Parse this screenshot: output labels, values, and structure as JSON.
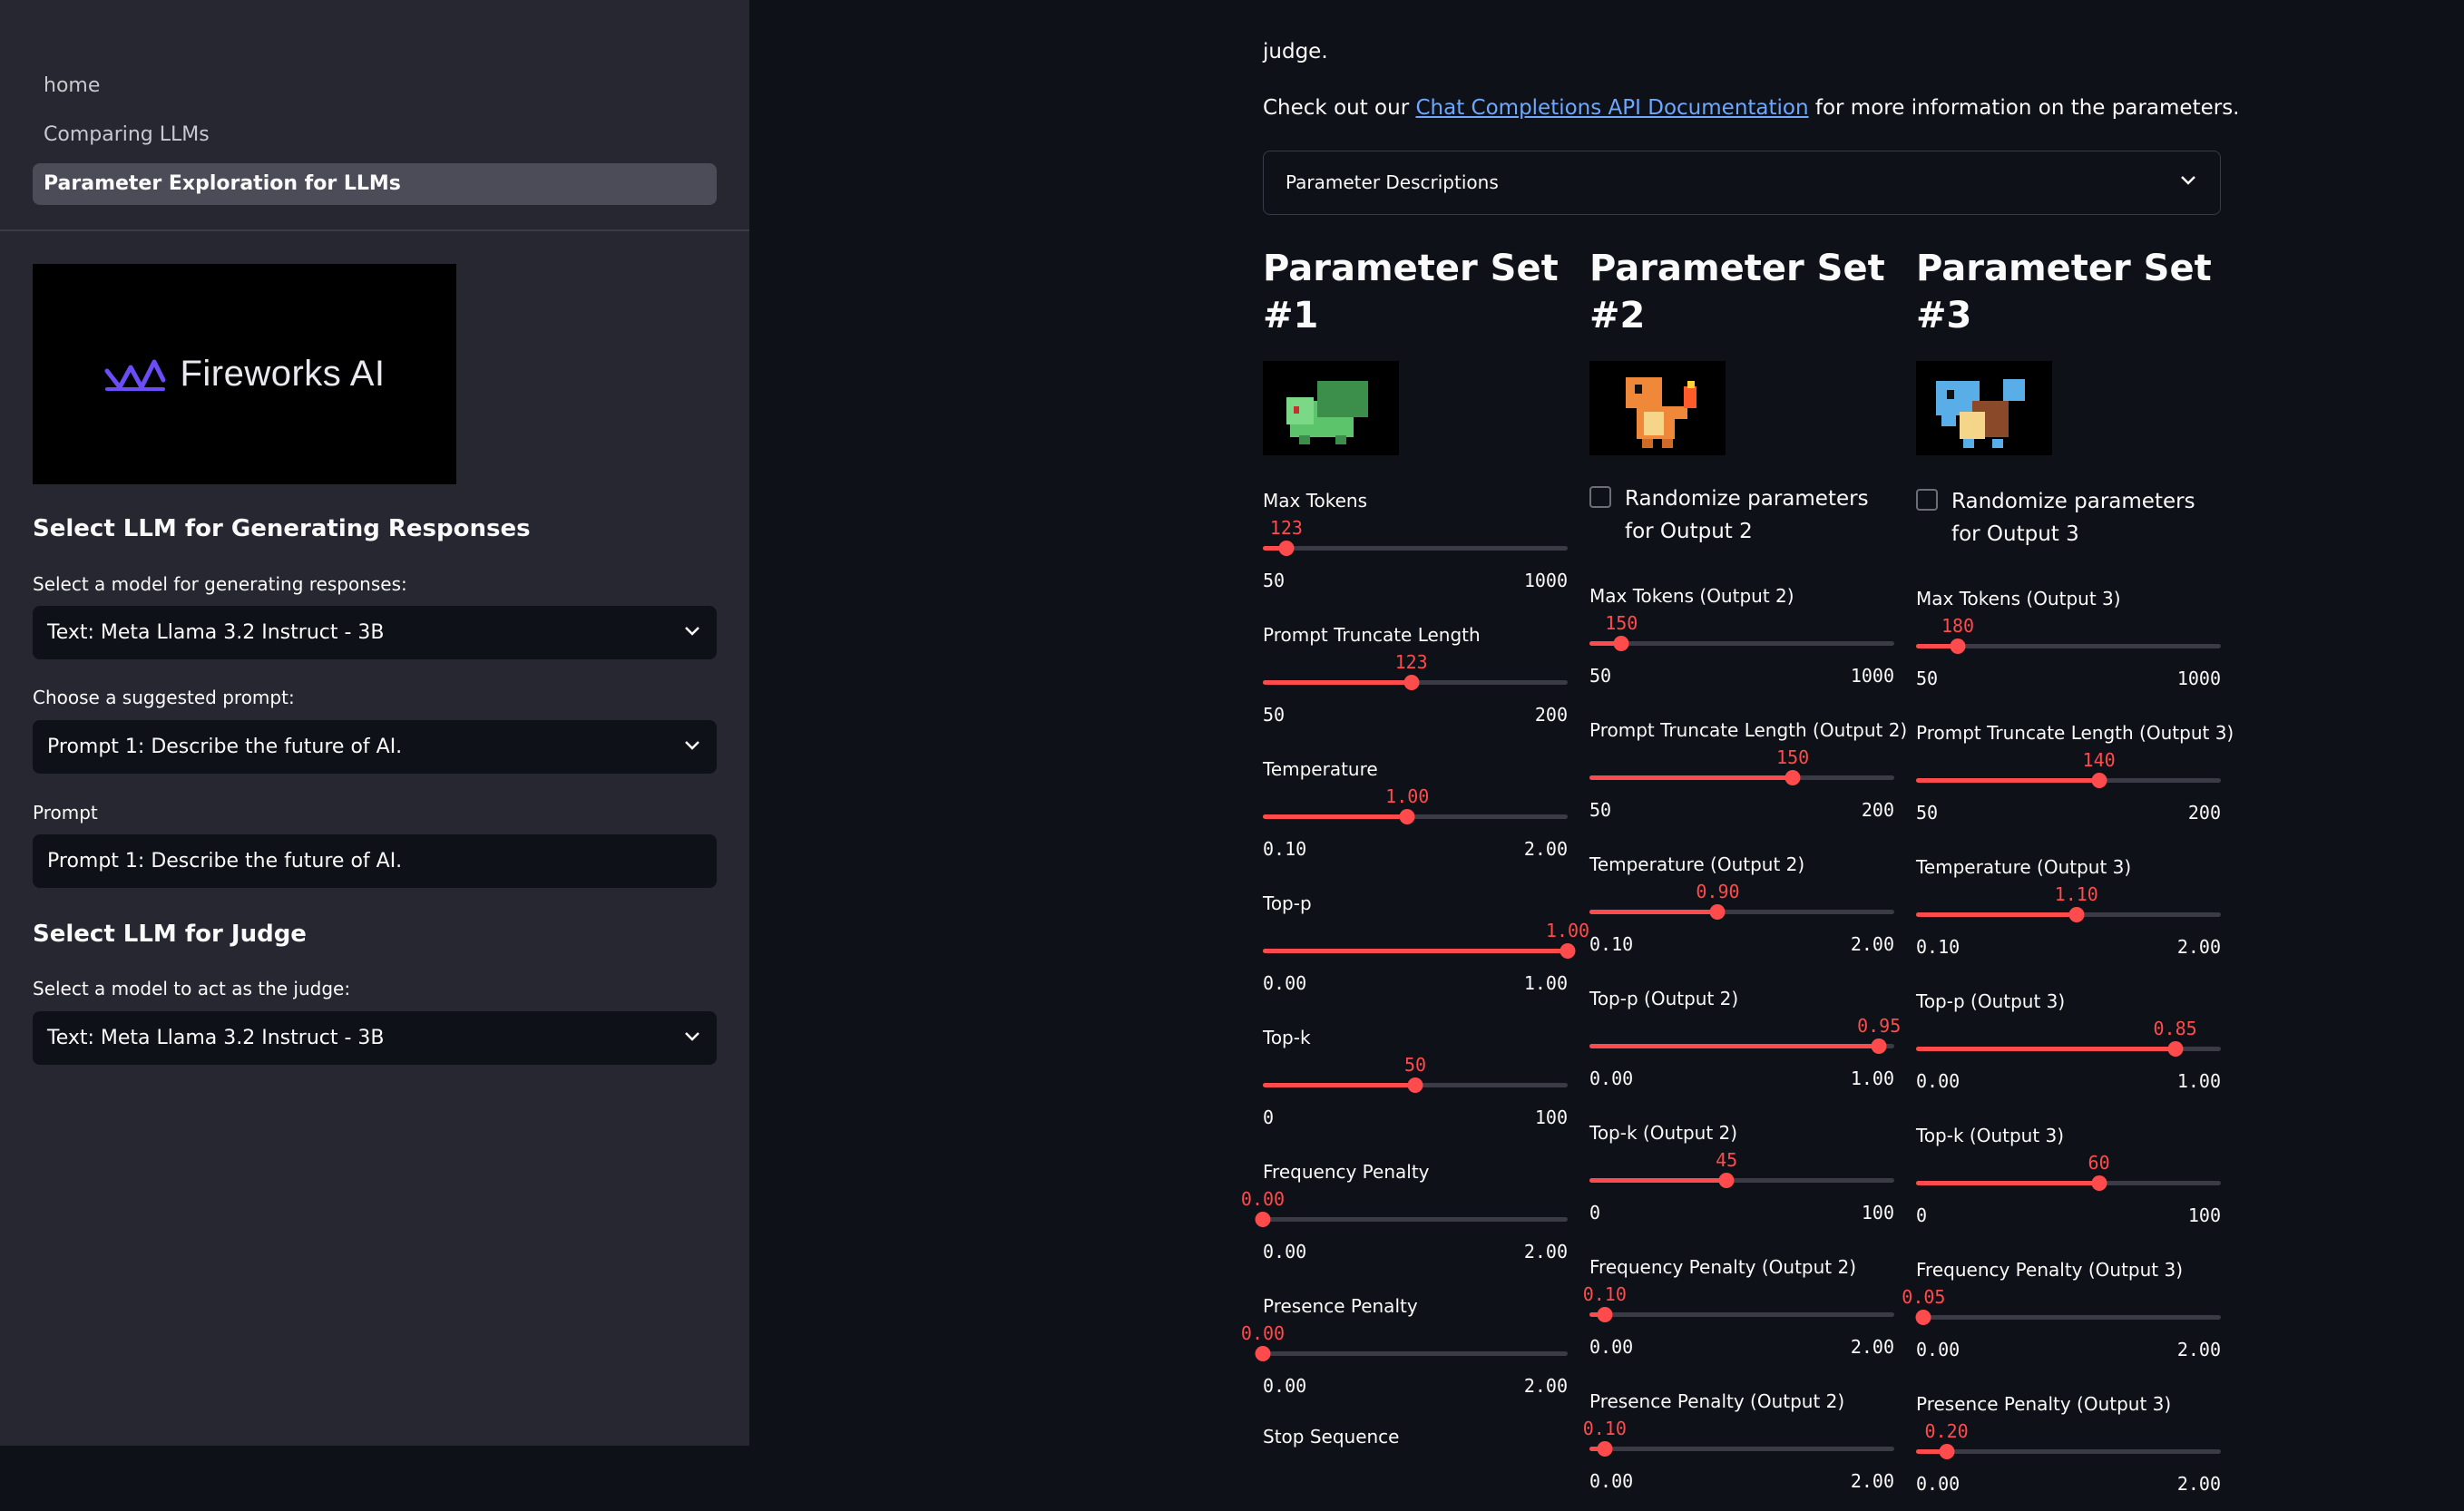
{
  "sidebar": {
    "nav": [
      {
        "label": "home",
        "active": false
      },
      {
        "label": "Comparing LLMs",
        "active": false
      },
      {
        "label": "Parameter Exploration for LLMs",
        "active": true
      }
    ],
    "logo_text": "Fireworks AI",
    "gen_heading": "Select LLM for Generating Responses",
    "gen_model_label": "Select a model for generating responses:",
    "gen_model_value": "Text: Meta Llama 3.2 Instruct - 3B",
    "prompt_choice_label": "Choose a suggested prompt:",
    "prompt_choice_value": "Prompt 1: Describe the future of AI.",
    "prompt_label": "Prompt",
    "prompt_value": "Prompt 1: Describe the future of AI.",
    "judge_heading": "Select LLM for Judge",
    "judge_model_label": "Select a model to act as the judge:",
    "judge_model_value": "Text: Meta Llama 3.2 Instruct - 3B"
  },
  "main": {
    "intro_tail": "judge.",
    "docs_prefix": "Check out our",
    "docs_link": "Chat Completions API Documentation",
    "docs_suffix": "for more information on the parameters.",
    "expander_label": "Parameter Descriptions"
  },
  "columns": [
    {
      "title_line1": "Parameter Set",
      "title_line2": "#1",
      "sprite": "bulbasaur-sprite",
      "sprite_color": "#5cc46a",
      "randomize": null,
      "sliders": [
        {
          "label": "Max Tokens",
          "value": "123",
          "min": "50",
          "max": "1000",
          "fraction": 0.077
        },
        {
          "label": "Prompt Truncate Length",
          "value": "123",
          "min": "50",
          "max": "200",
          "fraction": 0.487
        },
        {
          "label": "Temperature",
          "value": "1.00",
          "min": "0.10",
          "max": "2.00",
          "fraction": 0.474
        },
        {
          "label": "Top-p",
          "value": "1.00",
          "min": "0.00",
          "max": "1.00",
          "fraction": 1.0
        },
        {
          "label": "Top-k",
          "value": "50",
          "min": "0",
          "max": "100",
          "fraction": 0.5
        },
        {
          "label": "Frequency Penalty",
          "value": "0.00",
          "min": "0.00",
          "max": "2.00",
          "fraction": 0.0
        },
        {
          "label": "Presence Penalty",
          "value": "0.00",
          "min": "0.00",
          "max": "2.00",
          "fraction": 0.0
        }
      ],
      "tail_label": "Stop Sequence"
    },
    {
      "title_line1": "Parameter Set",
      "title_line2": "#2",
      "sprite": "charmander-sprite",
      "sprite_color": "#f0883a",
      "randomize": "Randomize parameters for Output 2",
      "sliders": [
        {
          "label": "Max Tokens (Output 2)",
          "value": "150",
          "min": "50",
          "max": "1000",
          "fraction": 0.105
        },
        {
          "label": "Prompt Truncate Length (Output 2)",
          "value": "150",
          "min": "50",
          "max": "200",
          "fraction": 0.667
        },
        {
          "label": "Temperature (Output 2)",
          "value": "0.90",
          "min": "0.10",
          "max": "2.00",
          "fraction": 0.421
        },
        {
          "label": "Top-p (Output 2)",
          "value": "0.95",
          "min": "0.00",
          "max": "1.00",
          "fraction": 0.95
        },
        {
          "label": "Top-k (Output 2)",
          "value": "45",
          "min": "0",
          "max": "100",
          "fraction": 0.45
        },
        {
          "label": "Frequency Penalty (Output 2)",
          "value": "0.10",
          "min": "0.00",
          "max": "2.00",
          "fraction": 0.05
        },
        {
          "label": "Presence Penalty (Output 2)",
          "value": "0.10",
          "min": "0.00",
          "max": "2.00",
          "fraction": 0.05
        }
      ]
    },
    {
      "title_line1": "Parameter Set",
      "title_line2": "#3",
      "sprite": "squirtle-sprite",
      "sprite_color": "#5aaee8",
      "randomize": "Randomize parameters for Output 3",
      "sliders": [
        {
          "label": "Max Tokens (Output 3)",
          "value": "180",
          "min": "50",
          "max": "1000",
          "fraction": 0.137
        },
        {
          "label": "Prompt Truncate Length (Output 3)",
          "value": "140",
          "min": "50",
          "max": "200",
          "fraction": 0.6
        },
        {
          "label": "Temperature (Output 3)",
          "value": "1.10",
          "min": "0.10",
          "max": "2.00",
          "fraction": 0.526
        },
        {
          "label": "Top-p (Output 3)",
          "value": "0.85",
          "min": "0.00",
          "max": "1.00",
          "fraction": 0.85
        },
        {
          "label": "Top-k (Output 3)",
          "value": "60",
          "min": "0",
          "max": "100",
          "fraction": 0.6
        },
        {
          "label": "Frequency Penalty (Output 3)",
          "value": "0.05",
          "min": "0.00",
          "max": "2.00",
          "fraction": 0.025
        },
        {
          "label": "Presence Penalty (Output 3)",
          "value": "0.20",
          "min": "0.00",
          "max": "2.00",
          "fraction": 0.1
        }
      ]
    }
  ],
  "colors": {
    "accent": "#ff4b4b",
    "sidebar_bg": "#262730",
    "main_bg": "#0e1117",
    "link": "#6ea8fe"
  }
}
